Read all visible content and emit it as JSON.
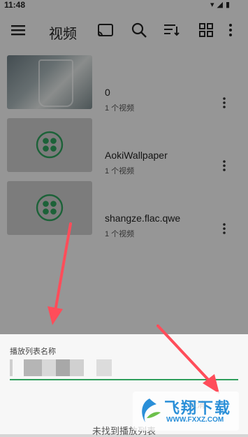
{
  "status_bar": {
    "time": "11:48"
  },
  "toolbar": {
    "title": "视频"
  },
  "folders": [
    {
      "name": "0",
      "count": "1 个视频",
      "thumb": "photo"
    },
    {
      "name": "AokiWallpaper",
      "count": "1 个视频",
      "thumb": "folder-icon"
    },
    {
      "name": "shangze.flac.qwe",
      "count": "1 个视频",
      "thumb": "folder-icon"
    }
  ],
  "dialog": {
    "label": "播放列表名称",
    "cancel_partial": "取消",
    "empty_message": "未找到播放列表"
  },
  "watermark": {
    "text": "飞翔下载",
    "url": "WWW.FXXZ.COM"
  },
  "colors": {
    "accent": "#2e9e5b",
    "arrow": "#ff4d5a"
  }
}
